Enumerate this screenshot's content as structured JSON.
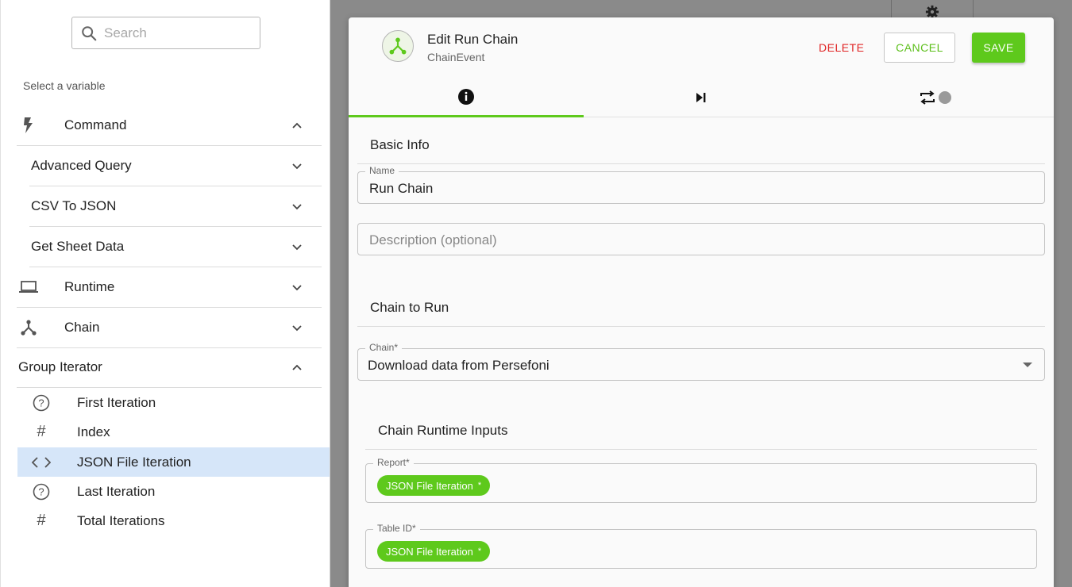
{
  "search": {
    "placeholder": "Search"
  },
  "variables": {
    "heading": "Select a variable",
    "groups": [
      {
        "label": "Command",
        "icon": "lightning-icon",
        "expanded": true
      },
      {
        "label": "Advanced Query"
      },
      {
        "label": "CSV To JSON"
      },
      {
        "label": "Get Sheet Data"
      },
      {
        "label": "Runtime",
        "icon": "laptop-icon"
      },
      {
        "label": "Chain",
        "icon": "chain-icon"
      },
      {
        "label": "Group Iterator",
        "expanded": true
      }
    ],
    "iterator_items": [
      {
        "label": "First Iteration",
        "icon": "question-circle-icon"
      },
      {
        "label": "Index",
        "icon": "hash-icon"
      },
      {
        "label": "JSON File Iteration",
        "icon": "code-icon",
        "selected": true
      },
      {
        "label": "Last Iteration",
        "icon": "question-circle-icon"
      },
      {
        "label": "Total Iterations",
        "icon": "hash-icon"
      }
    ]
  },
  "dialog": {
    "title": "Edit Run Chain",
    "subtitle": "ChainEvent",
    "delete_label": "DELETE",
    "cancel_label": "CANCEL",
    "save_label": "SAVE",
    "tabs": [
      {
        "name": "info",
        "icon": "info-icon",
        "active": true
      },
      {
        "name": "skip",
        "icon": "skip-next-icon"
      },
      {
        "name": "repeat",
        "icon": "repeat-toggle-icon"
      }
    ],
    "basic_info": {
      "heading": "Basic Info",
      "name_label": "Name",
      "name_value": "Run Chain",
      "description_placeholder": "Description (optional)"
    },
    "chain_to_run": {
      "heading": "Chain to Run",
      "chain_label": "Chain*",
      "chain_value": "Download data from Persefoni"
    },
    "runtime_inputs": {
      "heading": "Chain Runtime Inputs",
      "report_label": "Report*",
      "report_chip": "JSON File Iteration",
      "table_label": "Table ID*",
      "table_chip": "JSON File Iteration",
      "chip_marker": "*"
    }
  },
  "colors": {
    "accent": "#5ec91c",
    "danger": "#e02424",
    "selected_row": "#d6e6f9"
  }
}
